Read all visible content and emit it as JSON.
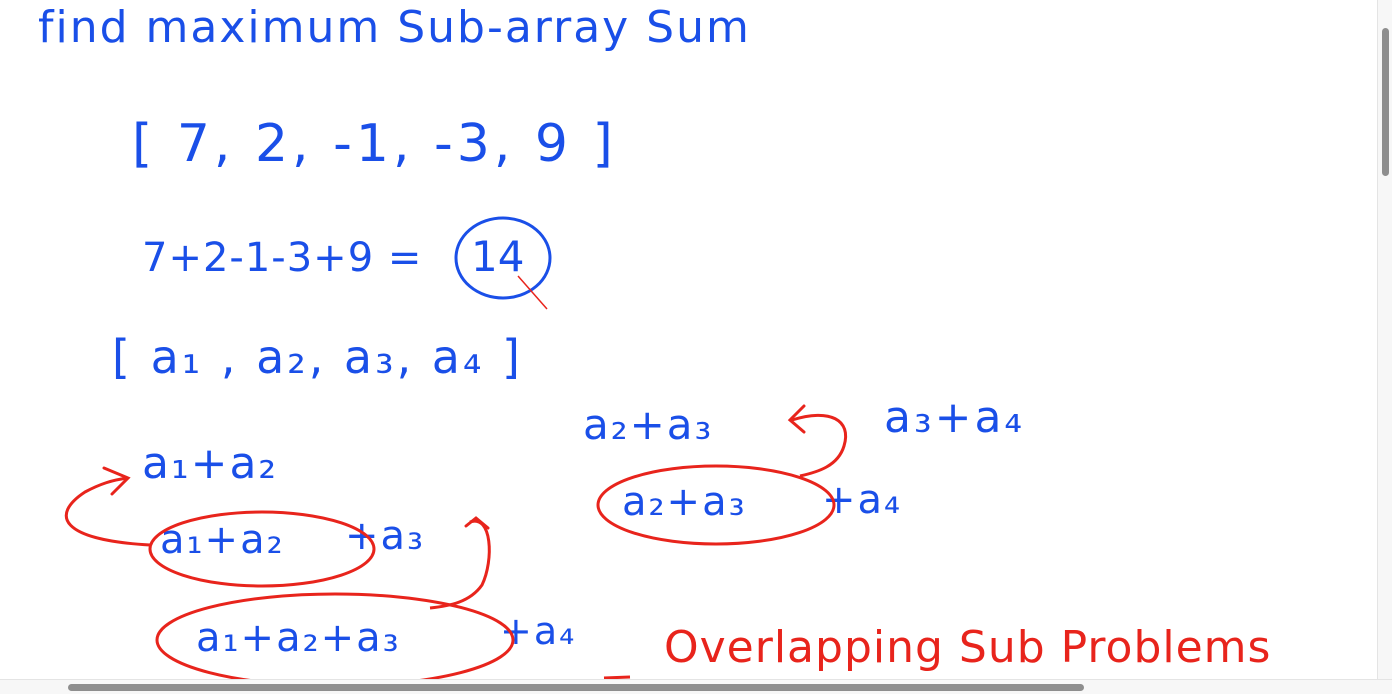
{
  "whiteboard": {
    "title": "find maximum Sub-array Sum",
    "array": "[ 7, 2, -1, -3, 9 ]",
    "sum_expression": "7+2-1-3+9 =",
    "result": "14",
    "symbolic_array": "[ a₁ , a₂, a₃, a₄ ]",
    "left_chain": {
      "term1": "a₁+a₂",
      "term2": "a₁+a₂",
      "term2_tail": "+a₃",
      "term3": "a₁+a₂+a₃",
      "term3_tail": "+a₄"
    },
    "right_chain": {
      "top": "a₂+a₃",
      "top_right": "a₃+a₄",
      "bottom": "a₂+a₃",
      "bottom_tail": "+a₄"
    },
    "note": "Overlapping Sub Problems"
  },
  "colors": {
    "ink_blue": "#1a4fe8",
    "ink_red": "#e8241c",
    "background": "#ffffff",
    "scrollbar": "#8e8e8e"
  }
}
